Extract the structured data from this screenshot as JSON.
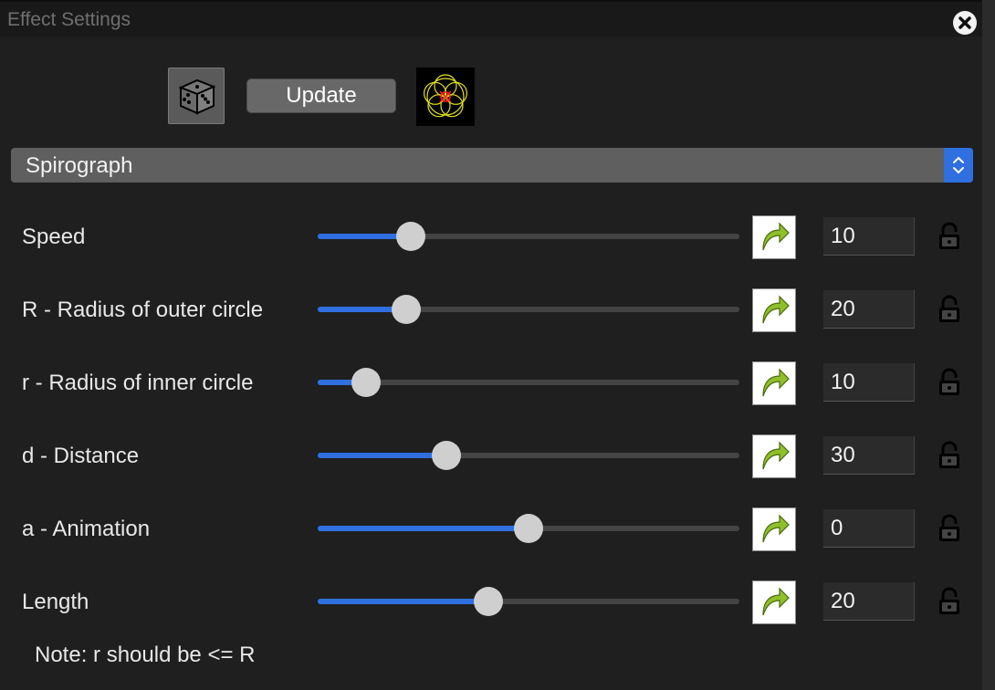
{
  "window": {
    "title": "Effect Settings"
  },
  "toolbar": {
    "update_label": "Update"
  },
  "effect_select": {
    "selected": "Spirograph"
  },
  "parameters": [
    {
      "label": "Speed",
      "value": "10",
      "slider_fraction": 0.22
    },
    {
      "label": "R - Radius of outer circle",
      "value": "20",
      "slider_fraction": 0.21
    },
    {
      "label": "r - Radius of inner circle",
      "value": "10",
      "slider_fraction": 0.115
    },
    {
      "label": "d - Distance",
      "value": "30",
      "slider_fraction": 0.305
    },
    {
      "label": "a - Animation",
      "value": "0",
      "slider_fraction": 0.5
    },
    {
      "label": "Length",
      "value": "20",
      "slider_fraction": 0.405
    }
  ],
  "note": "Note: r should be <= R",
  "colors": {
    "accent": "#2f6fe0",
    "slider_track": "#444444",
    "thumb": "#cfcfcf",
    "reset_arrow": "#8fbf2a",
    "preview_outer": "#e0e020",
    "preview_inner": "#ff2020"
  }
}
